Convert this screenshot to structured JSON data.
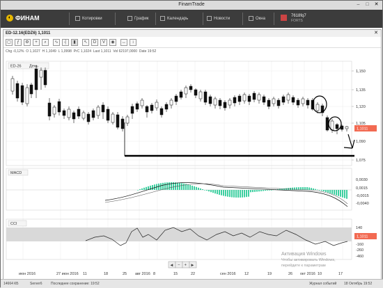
{
  "window": {
    "title": "FinamTrade"
  },
  "menu": {
    "logo": "ФИНАМ",
    "items": [
      {
        "label": "Котировки",
        "icon": "quotes-icon"
      },
      {
        "label": "График",
        "icon": "chart-icon"
      },
      {
        "label": "Календарь",
        "icon": "calendar-icon"
      },
      {
        "label": "Новости",
        "icon": "news-icon"
      },
      {
        "label": "Окна",
        "icon": "windows-icon"
      }
    ],
    "account_id": "7618fq7",
    "account_type": "FORTS"
  },
  "chart_window": {
    "title": "ED-12.16(EDZ6) 1,1011"
  },
  "ohlc_line": {
    "chg": "Chg -0,12%",
    "open": "O 1,1027",
    "high": "H 1,1049",
    "low": "L 1,0998",
    "prc": "PrC 1,1024",
    "last": "Last 1,1011",
    "vol": "Vol 62197,0000",
    "date": "Date 19:52"
  },
  "price_panel": {
    "symbol_label": "ED-26",
    "interval_label": "День",
    "current_value": "1,1011",
    "current_color": "#f26a52",
    "axis_ticks": [
      "1,150",
      "1,135",
      "1,120",
      "1,105",
      "1,090",
      "1,075"
    ]
  },
  "macd_panel": {
    "label": "MACD",
    "axis_ticks": [
      "0,0030",
      "0,0015",
      "-0,0015",
      "-0,0040"
    ]
  },
  "cci_panel": {
    "label": "CCI",
    "current_value": "1,1011",
    "axis_ticks": [
      "140",
      "60",
      "-160",
      "-260",
      "-460"
    ]
  },
  "x_axis": {
    "labels": [
      "июн 2016",
      "27 июн 2016",
      "11",
      "18",
      "25",
      "авг 2016",
      "8",
      "15",
      "22",
      "сен 2016",
      "12",
      "19",
      "26",
      "окт 2016",
      "10",
      "17"
    ]
  },
  "zoom_controls": [
    "◀",
    "−",
    "+",
    "▶"
  ],
  "status": {
    "traffic": "14664 КБ",
    "server": "Server6",
    "save": "Последнее сохранение: 19:52",
    "journal": "Журнал событий",
    "datetime": "18 Октябрь 19:52"
  },
  "activation": {
    "title": "Активация Windows",
    "line1": "Чтобы активировать Windows,",
    "line2": "перейдите к параметрам"
  },
  "colors": {
    "up": "#ffffff",
    "down": "#111111",
    "macd_hist": "#3dcfa0",
    "cci_band": "#d9d9d9"
  }
}
